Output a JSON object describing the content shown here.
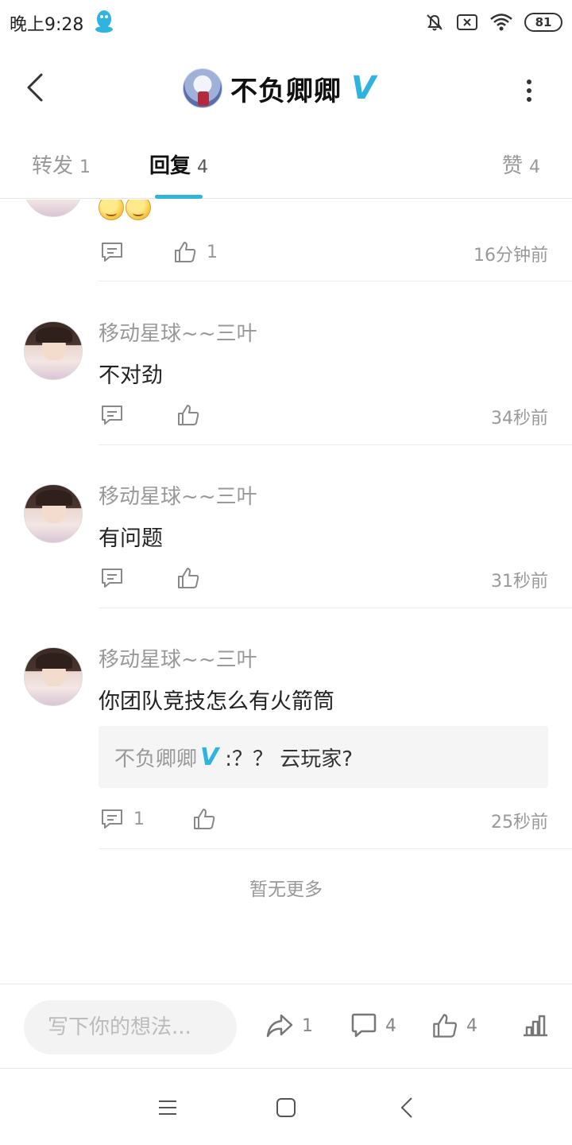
{
  "status_bar": {
    "time": "晚上9:28",
    "battery": "81",
    "icons": [
      "qq-icon",
      "bell-muted-icon",
      "sim-x-icon",
      "wifi-icon",
      "battery-icon"
    ]
  },
  "header": {
    "title": "不负卿卿",
    "verified_badge": "V",
    "icons": [
      "back-icon",
      "avatar",
      "more-icon"
    ]
  },
  "tabs": [
    {
      "label": "转发",
      "count": "1",
      "active": false
    },
    {
      "label": "回复",
      "count": "4",
      "active": true
    },
    {
      "label": "赞",
      "count": "4",
      "active": false
    }
  ],
  "comments": [
    {
      "username": "",
      "content": "",
      "emoji_count": 2,
      "reply_count": "",
      "like_count": "1",
      "time": "16分钟前"
    },
    {
      "username": "移动星球~~三叶",
      "content": "不对劲",
      "reply_count": "",
      "like_count": "",
      "time": "34秒前"
    },
    {
      "username": "移动星球~~三叶",
      "content": "有问题",
      "reply_count": "",
      "like_count": "",
      "time": "31秒前"
    },
    {
      "username": "移动星球~~三叶",
      "content": "你团队竞技怎么有火箭筒",
      "quote": {
        "author": "不负卿卿",
        "badge": "V",
        "text": ":？？ 云玩家?"
      },
      "reply_count": "1",
      "like_count": "",
      "time": "25秒前"
    }
  ],
  "no_more": "暂无更多",
  "bottom_bar": {
    "input_placeholder": "写下你的想法...",
    "share_count": "1",
    "comment_count": "4",
    "like_count": "4"
  },
  "colors": {
    "accent": "#2fb3e0",
    "muted_text": "#999999",
    "primary_text": "#222222"
  }
}
